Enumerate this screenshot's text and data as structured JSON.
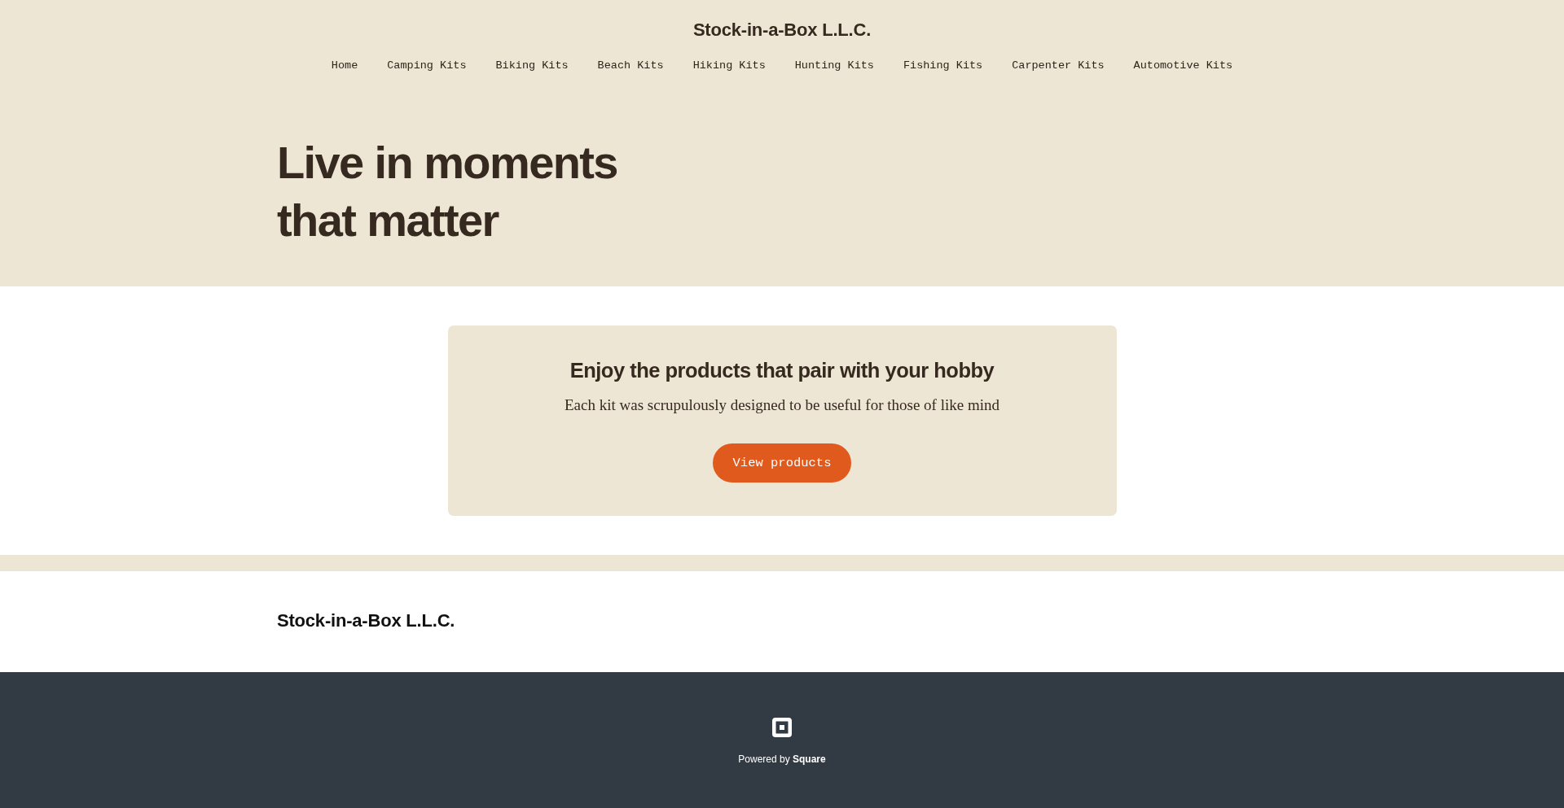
{
  "header": {
    "brand": "Stock-in-a-Box L.L.C.",
    "nav": [
      "Home",
      "Camping Kits",
      "Biking Kits",
      "Beach Kits",
      "Hiking Kits",
      "Hunting Kits",
      "Fishing Kits",
      "Carpenter Kits",
      "Automotive Kits"
    ]
  },
  "hero": {
    "title": "Live in moments that matter"
  },
  "promo": {
    "title": "Enjoy the products that pair with your hobby",
    "text": "Each kit was scrupulously designed to be useful for those of like mind",
    "button": "View products"
  },
  "footer": {
    "brand": "Stock-in-a-Box L.L.C."
  },
  "powered_by": {
    "text": "Powered by **Square**"
  }
}
